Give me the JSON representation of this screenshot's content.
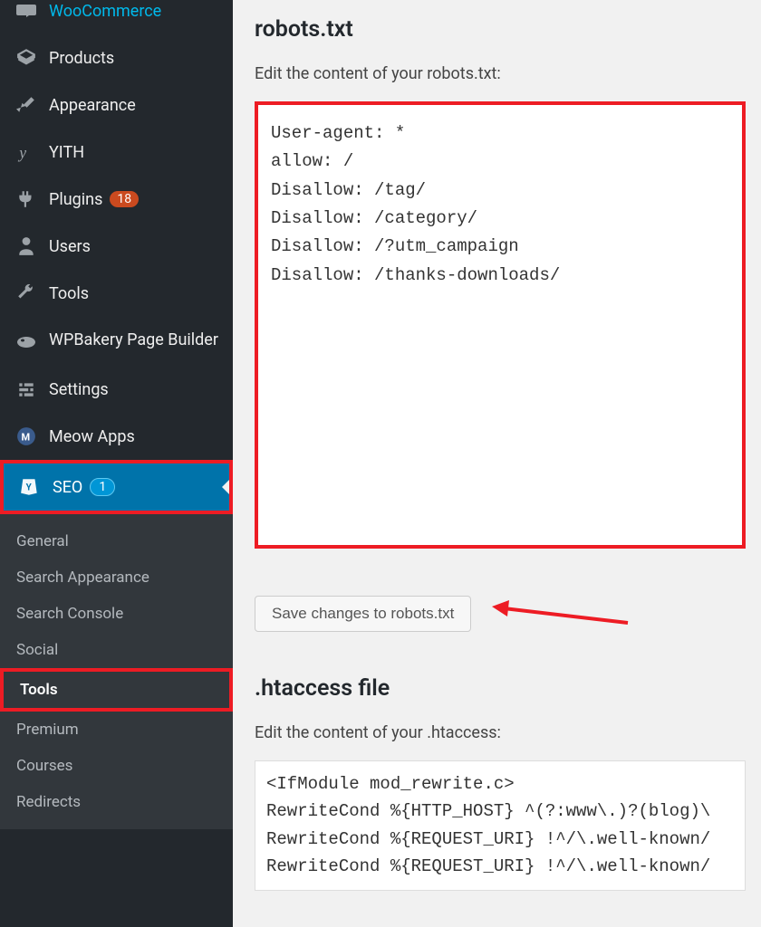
{
  "sidebar": {
    "items": [
      {
        "label": "WooCommerce",
        "icon": "woocommerce-icon"
      },
      {
        "label": "Products",
        "icon": "products-icon"
      },
      {
        "label": "Appearance",
        "icon": "appearance-icon"
      },
      {
        "label": "YITH",
        "icon": "yith-icon"
      },
      {
        "label": "Plugins",
        "icon": "plugins-icon",
        "badge": "18"
      },
      {
        "label": "Users",
        "icon": "users-icon"
      },
      {
        "label": "Tools",
        "icon": "tools-icon"
      },
      {
        "label": "WPBakery Page Builder",
        "icon": "wpbakery-icon"
      },
      {
        "label": "Settings",
        "icon": "settings-icon"
      },
      {
        "label": "Meow Apps",
        "icon": "meow-icon"
      },
      {
        "label": "SEO",
        "icon": "seo-icon",
        "badge": "1"
      }
    ],
    "submenu": [
      {
        "label": "General"
      },
      {
        "label": "Search Appearance"
      },
      {
        "label": "Search Console"
      },
      {
        "label": "Social"
      },
      {
        "label": "Tools"
      },
      {
        "label": "Premium"
      },
      {
        "label": "Courses"
      },
      {
        "label": "Redirects"
      }
    ]
  },
  "main": {
    "robots": {
      "title": "robots.txt",
      "description": "Edit the content of your robots.txt:",
      "content": "User-agent: *\nallow: /\nDisallow: /tag/\nDisallow: /category/\nDisallow: /?utm_campaign\nDisallow: /thanks-downloads/",
      "save_label": "Save changes to robots.txt"
    },
    "htaccess": {
      "title": ".htaccess file",
      "description": "Edit the content of your .htaccess:",
      "content": "<IfModule mod_rewrite.c>\nRewriteCond %{HTTP_HOST} ^(?:www\\.)?(blog)\\\nRewriteCond %{REQUEST_URI} !^/\\.well-known/\nRewriteCond %{REQUEST_URI} !^/\\.well-known/"
    }
  }
}
